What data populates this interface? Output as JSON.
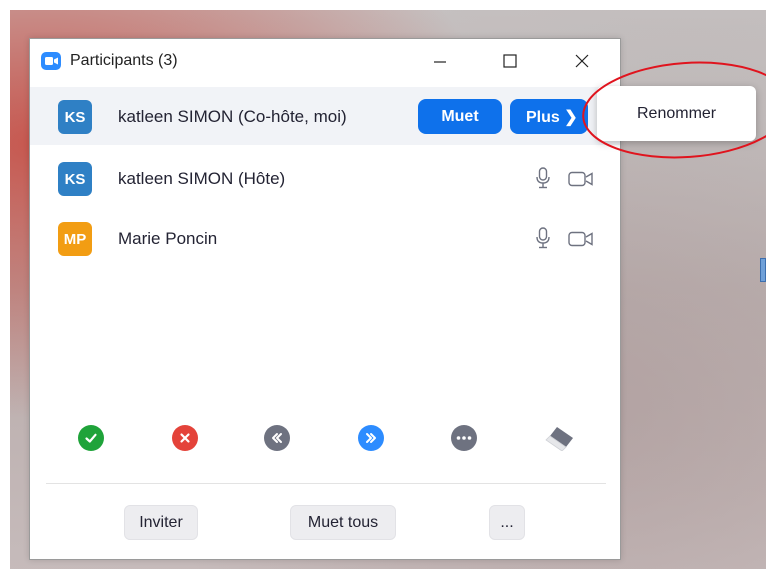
{
  "window": {
    "title": "Participants (3)",
    "minimize_icon": "minimize-icon",
    "maximize_icon": "maximize-icon",
    "close_icon": "close-icon"
  },
  "participants": [
    {
      "initials": "KS",
      "avatar_color": "#2f80c5",
      "name": "katleen SIMON (Co-hôte, moi)",
      "highlighted": true,
      "mute_label": "Muet",
      "more_label": "Plus ❯"
    },
    {
      "initials": "KS",
      "avatar_color": "#2f80c5",
      "name": "katleen SIMON (Hôte)",
      "mic_icon": "microphone-icon",
      "video_icon": "video-camera-icon"
    },
    {
      "initials": "MP",
      "avatar_color": "#f29d13",
      "name": "Marie Poncin",
      "mic_icon": "microphone-icon",
      "video_icon": "video-camera-icon"
    }
  ],
  "reactions": [
    {
      "icon": "yes-check-icon",
      "color": "#1fa33a"
    },
    {
      "icon": "no-x-icon",
      "color": "#e4433a"
    },
    {
      "icon": "go-slower-icon",
      "color": "#6e7280"
    },
    {
      "icon": "go-faster-icon",
      "color": "#2d8cff"
    },
    {
      "icon": "more-reactions-icon",
      "color": "#6e7280"
    },
    {
      "icon": "clear-all-eraser-icon",
      "color": "#6e7280"
    }
  ],
  "footer": {
    "invite_label": "Inviter",
    "mute_all_label": "Muet tous",
    "more_label": "..."
  },
  "context_menu": {
    "items": [
      "Renommer"
    ]
  },
  "colors": {
    "accent": "#0e71eb",
    "annotation": "#e0141e"
  }
}
